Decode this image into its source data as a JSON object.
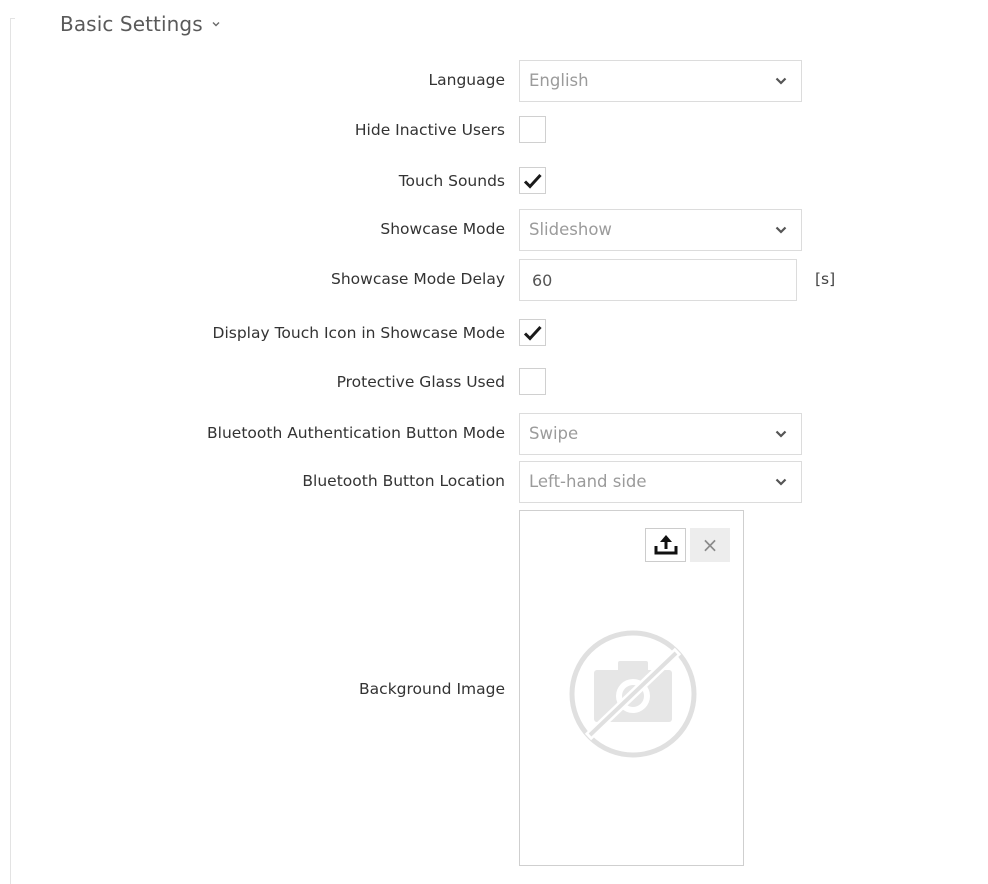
{
  "section": {
    "title": "Basic Settings",
    "chevron_icon": "chevron-down-icon"
  },
  "settings": {
    "language": {
      "label": "Language",
      "value": "English"
    },
    "hide_inactive_users": {
      "label": "Hide Inactive Users",
      "checked": false
    },
    "touch_sounds": {
      "label": "Touch Sounds",
      "checked": true
    },
    "showcase_mode": {
      "label": "Showcase Mode",
      "value": "Slideshow"
    },
    "showcase_mode_delay": {
      "label": "Showcase Mode Delay",
      "value": "60",
      "unit": "[s]"
    },
    "display_touch_icon": {
      "label": "Display Touch Icon in Showcase Mode",
      "checked": true
    },
    "protective_glass": {
      "label": "Protective Glass Used",
      "checked": false
    },
    "bluetooth_auth_mode": {
      "label": "Bluetooth Authentication Button Mode",
      "value": "Swipe"
    },
    "bluetooth_button_location": {
      "label": "Bluetooth Button Location",
      "value": "Left-hand side"
    },
    "background_image": {
      "label": "Background Image",
      "upload_icon": "upload-icon",
      "remove_label": "×",
      "placeholder_icon": "no-image-icon"
    }
  },
  "colors": {
    "label_text": "#333333",
    "select_text": "#9b9b9b",
    "border": "#dcdcdc"
  }
}
